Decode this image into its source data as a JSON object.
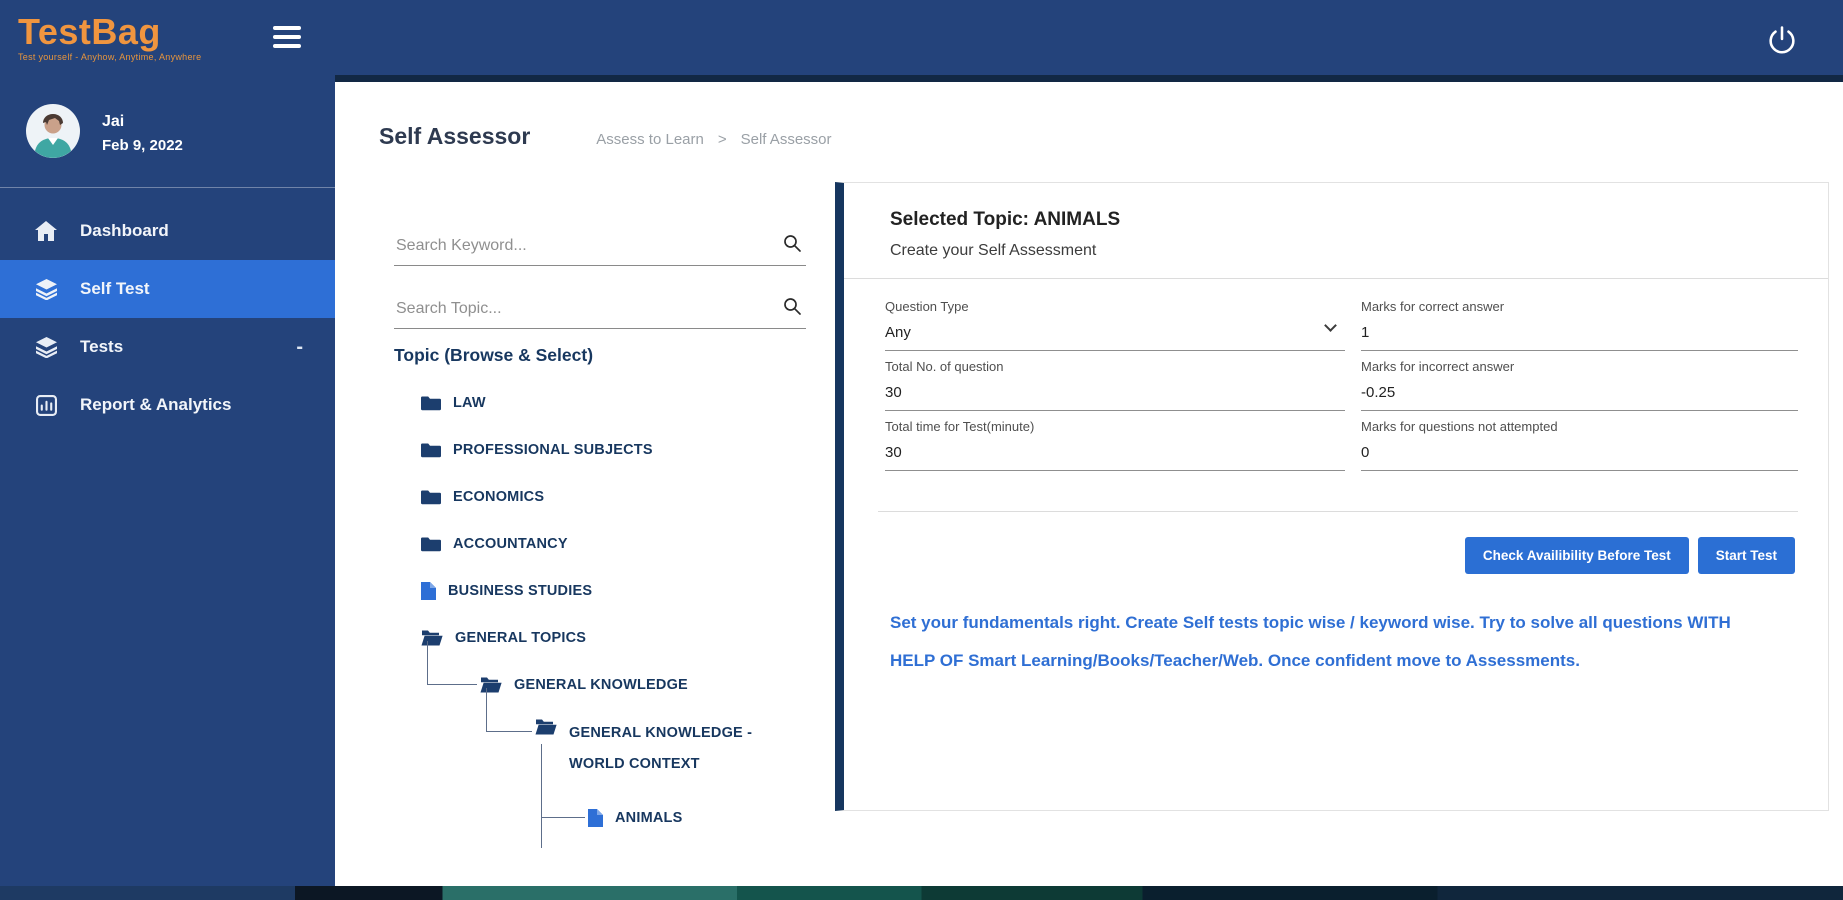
{
  "colors": {
    "sidebar_bg": "#24437b",
    "active_item": "#2e6fd6",
    "accent_blue": "#2b6fd4",
    "brand_orange": "#f0953f",
    "card_border_bar": "#16365f",
    "note_text": "#2f6fd4"
  },
  "icons": {
    "menu": "hamburger-icon",
    "logout": "power-icon",
    "search": "search-icon",
    "dashboard": "home-icon",
    "self_test": "layers-icon",
    "tests": "layers-icon",
    "reports": "bar-chart-icon",
    "folder": "folder-icon",
    "folder_open": "folder-open-icon",
    "file": "file-icon",
    "dropdown": "chevron-down-icon",
    "avatar": "user-avatar"
  },
  "header": {
    "logo_text": "TestBag",
    "tagline": "Test yourself - Anyhow, Anytime, Anywhere"
  },
  "sidebar": {
    "user_name": "Jai",
    "user_date": "Feb 9, 2022",
    "items": [
      {
        "label": "Dashboard"
      },
      {
        "label": "Self Test"
      },
      {
        "label": "Tests",
        "toggle": "-"
      },
      {
        "label": "Report & Analytics"
      }
    ]
  },
  "main": {
    "page_title": "Self Assessor",
    "breadcrumb": {
      "parent": "Assess to Learn",
      "sep": ">",
      "current": "Self Assessor"
    },
    "search_keyword_placeholder": "Search Keyword...",
    "search_topic_placeholder": "Search Topic...",
    "tree_heading": "Topic (Browse & Select)",
    "tree": [
      {
        "label": "LAW",
        "icon": "folder"
      },
      {
        "label": "PROFESSIONAL SUBJECTS",
        "icon": "folder"
      },
      {
        "label": "ECONOMICS",
        "icon": "folder"
      },
      {
        "label": "ACCOUNTANCY",
        "icon": "folder"
      },
      {
        "label": "BUSINESS STUDIES",
        "icon": "file"
      },
      {
        "label": "GENERAL TOPICS",
        "icon": "folder-open"
      },
      {
        "label": "GENERAL KNOWLEDGE",
        "icon": "folder-open"
      },
      {
        "label": "GENERAL KNOWLEDGE - WORLD CONTEXT",
        "icon": "folder-open"
      },
      {
        "label": "ANIMALS",
        "icon": "file"
      }
    ],
    "panel": {
      "title": "Selected Topic: ANIMALS",
      "subtitle": "Create your Self Assessment",
      "fields": [
        {
          "label": "Question Type",
          "value": "Any"
        },
        {
          "label": "Marks for correct answer",
          "value": "1"
        },
        {
          "label": "Total No. of question",
          "value": "30"
        },
        {
          "label": "Marks for incorrect answer",
          "value": "-0.25"
        },
        {
          "label": "Total time for Test(minute)",
          "value": "30"
        },
        {
          "label": "Marks for questions not attempted",
          "value": "0"
        }
      ],
      "check_button": "Check Availibility Before Test",
      "start_button": "Start Test",
      "note": "Set your fundamentals right. Create Self tests topic wise / keyword wise. Try to solve all questions WITH HELP OF Smart Learning/Books/Teacher/Web. Once confident move to Assessments."
    }
  }
}
